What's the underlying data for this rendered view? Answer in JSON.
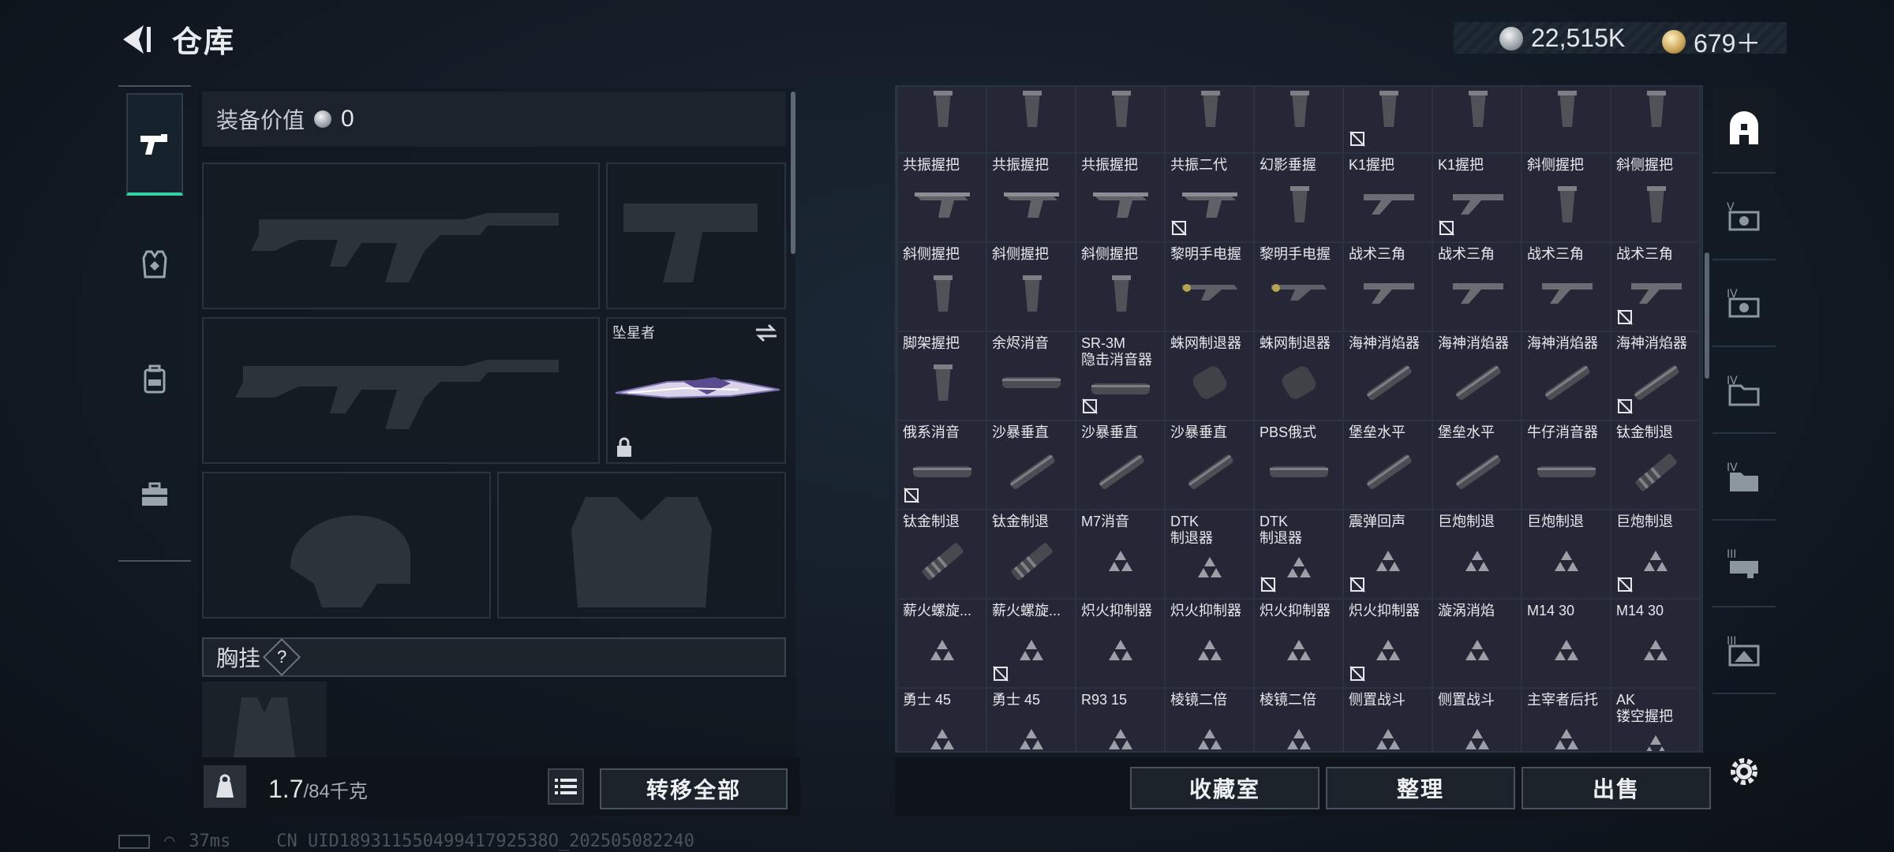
{
  "header": {
    "title": "仓库",
    "currency_silver": "22,515K",
    "currency_gold": "679＋"
  },
  "equipment": {
    "value_label": "装备价值",
    "value": "0",
    "melee_name": "坠星者",
    "chest_rig_label": "胸挂",
    "chest_rig_help": "?",
    "weight_current": "1.7",
    "weight_max": "/84千克",
    "transfer_all_label": "转移全部"
  },
  "status_bar": {
    "ping": "37ms",
    "uid": "CN UID18931155049941792538O_202505082240"
  },
  "grid": {
    "top_row_badges": [
      false,
      false,
      false,
      false,
      false,
      true,
      false,
      false,
      false
    ],
    "items": [
      {
        "name": "共振握把",
        "icon": "foregrip-icon",
        "badge": false
      },
      {
        "name": "共振握把",
        "icon": "foregrip-icon",
        "badge": false
      },
      {
        "name": "共振握把",
        "icon": "foregrip-icon",
        "badge": false
      },
      {
        "name": "共振二代",
        "icon": "foregrip-icon",
        "badge": true
      },
      {
        "name": "幻影垂握",
        "icon": "vertical-grip-icon",
        "badge": false
      },
      {
        "name": "K1握把",
        "icon": "angled-grip-icon",
        "badge": false
      },
      {
        "name": "K1握把",
        "icon": "angled-grip-icon",
        "badge": true
      },
      {
        "name": "斜侧握把",
        "icon": "vertical-grip-icon",
        "badge": false
      },
      {
        "name": "斜侧握把",
        "icon": "vertical-grip-icon",
        "badge": false
      },
      {
        "name": "斜侧握把",
        "icon": "vertical-grip-icon",
        "badge": false
      },
      {
        "name": "斜侧握把",
        "icon": "vertical-grip-icon",
        "badge": false
      },
      {
        "name": "斜侧握把",
        "icon": "vertical-grip-icon",
        "badge": false
      },
      {
        "name": "黎明手电握",
        "icon": "flashlight-grip-icon",
        "badge": false
      },
      {
        "name": "黎明手电握",
        "icon": "flashlight-grip-icon",
        "badge": false
      },
      {
        "name": "战术三角",
        "icon": "angled-grip-icon",
        "badge": false
      },
      {
        "name": "战术三角",
        "icon": "angled-grip-icon",
        "badge": false
      },
      {
        "name": "战术三角",
        "icon": "angled-grip-icon",
        "badge": false
      },
      {
        "name": "战术三角",
        "icon": "angled-grip-icon",
        "badge": true
      },
      {
        "name": "脚架握把",
        "icon": "vertical-grip-icon",
        "badge": false
      },
      {
        "name": "余烬消音",
        "icon": "suppressor-icon",
        "badge": false
      },
      {
        "name": "SR-3M\n隐击消音器",
        "icon": "suppressor-icon",
        "badge": true
      },
      {
        "name": "蛛网制退器",
        "icon": "muzzle-brake-icon",
        "badge": false
      },
      {
        "name": "蛛网制退器",
        "icon": "muzzle-brake-icon",
        "badge": false
      },
      {
        "name": "海神消焰器",
        "icon": "flash-hider-icon",
        "badge": false
      },
      {
        "name": "海神消焰器",
        "icon": "flash-hider-icon",
        "badge": false
      },
      {
        "name": "海神消焰器",
        "icon": "flash-hider-icon",
        "badge": false
      },
      {
        "name": "海神消焰器",
        "icon": "flash-hider-icon",
        "badge": true
      },
      {
        "name": "俄系消音",
        "icon": "suppressor-icon",
        "badge": true
      },
      {
        "name": "沙暴垂直",
        "icon": "flash-hider-icon",
        "badge": false
      },
      {
        "name": "沙暴垂直",
        "icon": "flash-hider-icon",
        "badge": false
      },
      {
        "name": "沙暴垂直",
        "icon": "flash-hider-icon",
        "badge": false
      },
      {
        "name": "PBS俄式",
        "icon": "suppressor-icon",
        "badge": false
      },
      {
        "name": "堡垒水平",
        "icon": "flash-hider-icon",
        "badge": false
      },
      {
        "name": "堡垒水平",
        "icon": "flash-hider-icon",
        "badge": false
      },
      {
        "name": "牛仔消音器",
        "icon": "suppressor-icon",
        "badge": false
      },
      {
        "name": "钛金制退",
        "icon": "compensator-icon",
        "badge": false
      },
      {
        "name": "钛金制退",
        "icon": "compensator-icon",
        "badge": false
      },
      {
        "name": "钛金制退",
        "icon": "compensator-icon",
        "badge": false
      },
      {
        "name": "M7消音",
        "icon": "placeholder-triangle-icon",
        "badge": false
      },
      {
        "name": "DTK\n制退器",
        "icon": "placeholder-triangle-icon",
        "badge": false
      },
      {
        "name": "DTK\n制退器",
        "icon": "placeholder-triangle-icon",
        "badge": true
      },
      {
        "name": "震弹回声",
        "icon": "placeholder-triangle-icon",
        "badge": true
      },
      {
        "name": "巨炮制退",
        "icon": "placeholder-triangle-icon",
        "badge": false
      },
      {
        "name": "巨炮制退",
        "icon": "placeholder-triangle-icon",
        "badge": false
      },
      {
        "name": "巨炮制退",
        "icon": "placeholder-triangle-icon",
        "badge": true
      },
      {
        "name": "薪火螺旋...",
        "icon": "placeholder-triangle-icon",
        "badge": false
      },
      {
        "name": "薪火螺旋...",
        "icon": "placeholder-triangle-icon",
        "badge": true
      },
      {
        "name": "炽火抑制器",
        "icon": "placeholder-triangle-icon",
        "badge": false
      },
      {
        "name": "炽火抑制器",
        "icon": "placeholder-triangle-icon",
        "badge": false
      },
      {
        "name": "炽火抑制器",
        "icon": "placeholder-triangle-icon",
        "badge": false
      },
      {
        "name": "炽火抑制器",
        "icon": "placeholder-triangle-icon",
        "badge": true
      },
      {
        "name": "漩涡消焰",
        "icon": "placeholder-triangle-icon",
        "badge": false
      },
      {
        "name": "M14 30",
        "icon": "placeholder-triangle-icon",
        "badge": false
      },
      {
        "name": "M14 30",
        "icon": "placeholder-triangle-icon",
        "badge": false
      },
      {
        "name": "勇士 45",
        "icon": "placeholder-triangle-icon",
        "badge": false
      },
      {
        "name": "勇士 45",
        "icon": "placeholder-triangle-icon",
        "badge": false
      },
      {
        "name": "R93 15",
        "icon": "placeholder-triangle-icon",
        "badge": false
      },
      {
        "name": "棱镜二倍",
        "icon": "placeholder-triangle-icon",
        "badge": false
      },
      {
        "name": "棱镜二倍",
        "icon": "placeholder-triangle-icon",
        "badge": false
      },
      {
        "name": "侧置战斗",
        "icon": "placeholder-triangle-icon",
        "badge": false
      },
      {
        "name": "侧置战斗",
        "icon": "placeholder-triangle-icon",
        "badge": false
      },
      {
        "name": "主宰者后托",
        "icon": "placeholder-triangle-icon",
        "badge": false
      },
      {
        "name": "AK\n镂空握把",
        "icon": "placeholder-triangle-icon",
        "badge": false
      }
    ]
  },
  "buttons": {
    "collection": "收藏室",
    "organize": "整理",
    "sell": "出售"
  },
  "colors": {
    "accent_green": "#35d1a3",
    "cell_bg": "#262736"
  }
}
